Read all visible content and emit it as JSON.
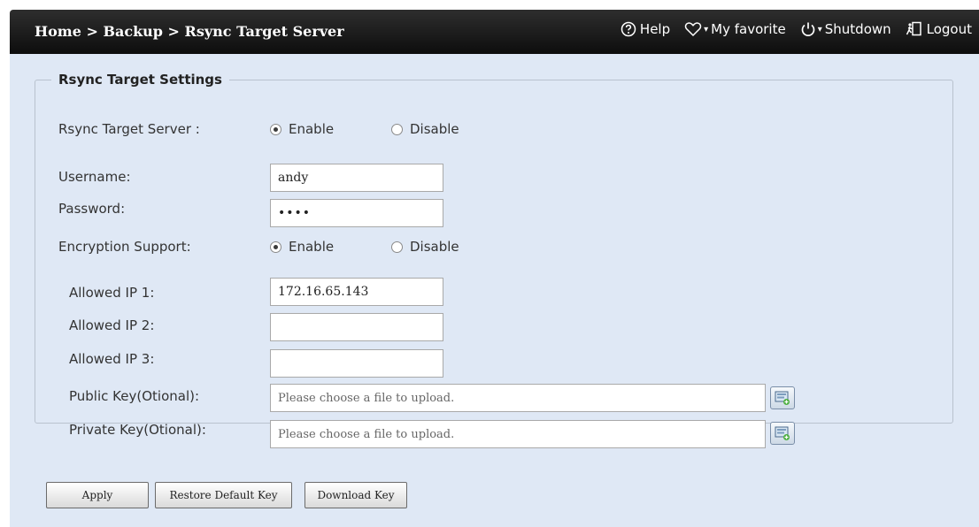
{
  "header": {
    "breadcrumb": "Home > Backup > Rsync Target Server",
    "help_label": "Help",
    "favorite_label": "My favorite",
    "shutdown_label": "Shutdown",
    "logout_label": "Logout",
    "dropdown_caret": "▾"
  },
  "settings": {
    "group_title": "Rsync Target Settings",
    "server_label": "Rsync Target Server :",
    "server_enable_label": "Enable",
    "server_disable_label": "Disable",
    "server_selected": "Enable",
    "username_label": "Username:",
    "username_value": "andy",
    "password_label": "Password:",
    "password_value": "••••",
    "encryption_label": "Encryption Support:",
    "encryption_enable_label": "Enable",
    "encryption_disable_label": "Disable",
    "encryption_selected": "Enable",
    "allowed_ip1_label": "Allowed IP 1:",
    "allowed_ip1_value": "172.16.65.143",
    "allowed_ip2_label": "Allowed IP 2:",
    "allowed_ip2_value": "",
    "allowed_ip3_label": "Allowed IP 3:",
    "allowed_ip3_value": "",
    "public_key_label": "Public Key(Otional):",
    "public_key_placeholder": "Please choose a file to upload.",
    "private_key_label": "Private Key(Otional):",
    "private_key_placeholder": "Please choose a file to upload."
  },
  "buttons": {
    "apply": "Apply",
    "restore_default_key": "Restore Default Key",
    "download_key": "Download Key"
  },
  "icons": {
    "help": "help-circle-icon",
    "favorite": "heart-icon",
    "shutdown": "power-icon",
    "logout": "logout-icon",
    "browse": "browse-file-icon"
  },
  "colors": {
    "header_bg": "#1a1a1a",
    "content_bg": "#dfe8f5",
    "group_border": "#b9c2ce"
  }
}
